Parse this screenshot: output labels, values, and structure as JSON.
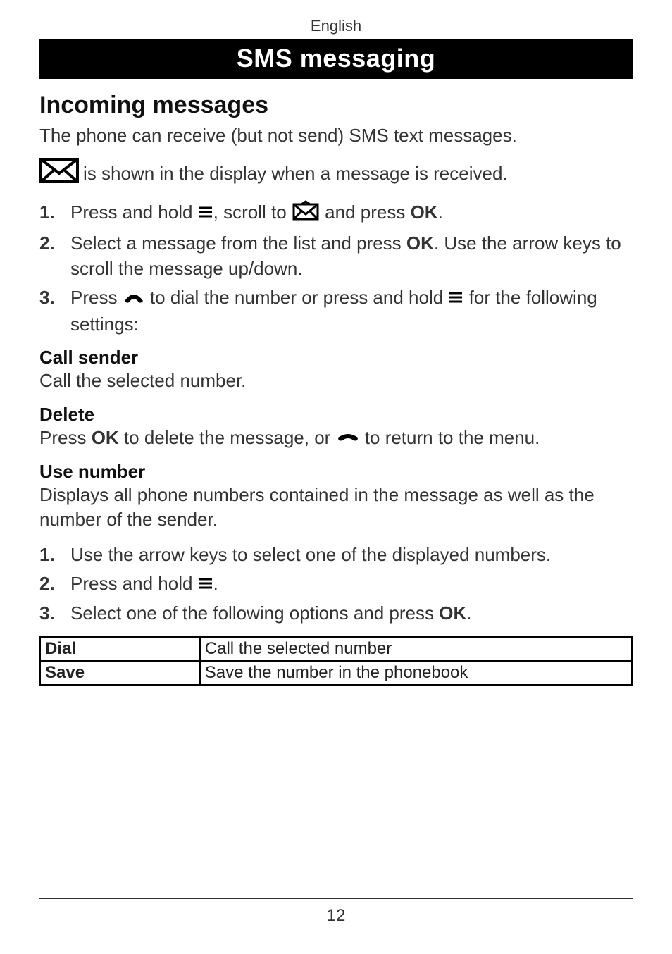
{
  "header": {
    "language": "English",
    "chapter": "SMS messaging"
  },
  "section": {
    "title": "Incoming messages",
    "intro": "The phone can receive (but not send) SMS text messages.",
    "received_line": " is shown in the display when a message is received.",
    "steps1": {
      "s1_a": "Press and hold ",
      "s1_b": ", scroll to ",
      "s1_c": " and press ",
      "s1_d": ".",
      "s2_a": "Select a message from the list and press ",
      "s2_b": ". Use the arrow keys to scroll the message up/down.",
      "s3_a": "Press ",
      "s3_b": " to dial the number or press and hold ",
      "s3_c": " for the following settings:"
    },
    "ok": "OK",
    "call_sender_h": "Call sender",
    "call_sender_b": "Call the selected number.",
    "delete_h": "Delete",
    "delete_a": "Press ",
    "delete_b": " to delete the message, or ",
    "delete_c": " to return to the menu.",
    "use_number_h": "Use number",
    "use_number_b": "Displays all phone numbers contained in the message as well as the number of the sender.",
    "steps2": {
      "s1": "Use the arrow keys to select one of the displayed numbers.",
      "s2_a": "Press and hold ",
      "s2_b": ".",
      "s3_a": "Select one of the following options and press ",
      "s3_b": "."
    },
    "table": {
      "r1c1": "Dial",
      "r1c2": "Call the selected number",
      "r2c1": "Save",
      "r2c2": "Save the number in the phonebook"
    }
  },
  "page_number": "12"
}
